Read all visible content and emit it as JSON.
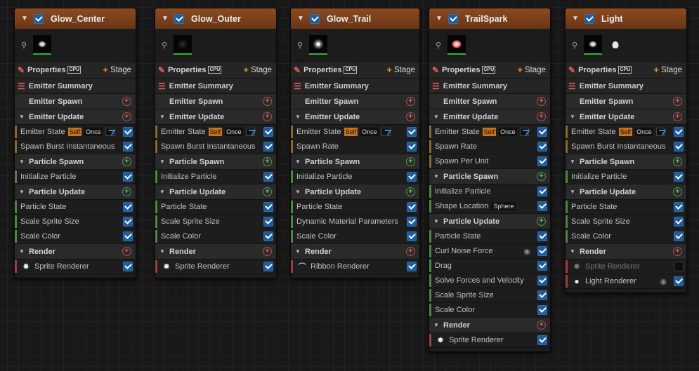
{
  "emitters": [
    {
      "name": "Glow_Center",
      "thumbnails": [
        "white-glow-dot"
      ],
      "properties_label": "Properties",
      "cpu_label": "CPU",
      "stage_label": "Stage",
      "summary_label": "Emitter Summary",
      "groups": [
        {
          "label": "Emitter Spawn",
          "collapsible": false,
          "add_color": "red",
          "modules": []
        },
        {
          "label": "Emitter Update",
          "collapsible": true,
          "add_color": "red",
          "modules": [
            {
              "label": "Emitter State",
              "tags": [
                "Self",
                "Once"
              ],
              "curve": true,
              "enabled": true
            },
            {
              "label": "Spawn Burst Instantaneous",
              "enabled": true
            }
          ]
        },
        {
          "label": "Particle Spawn",
          "collapsible": true,
          "add_color": "green",
          "modules": [
            {
              "label": "Initialize Particle",
              "enabled": true
            }
          ]
        },
        {
          "label": "Particle Update",
          "collapsible": true,
          "add_color": "green",
          "modules": [
            {
              "label": "Particle State",
              "enabled": true
            },
            {
              "label": "Scale Sprite Size",
              "enabled": true
            },
            {
              "label": "Scale Color",
              "enabled": true
            }
          ]
        },
        {
          "label": "Render",
          "collapsible": true,
          "add_color": "red",
          "modules": [
            {
              "label": "Sprite Renderer",
              "icon": "sprite-icon",
              "enabled": true
            }
          ]
        }
      ]
    },
    {
      "name": "Glow_Outer",
      "thumbnails": [
        "dim-glow"
      ],
      "properties_label": "Properties",
      "cpu_label": "CPU",
      "stage_label": "Stage",
      "summary_label": "Emitter Summary",
      "groups": [
        {
          "label": "Emitter Spawn",
          "collapsible": false,
          "add_color": "red",
          "modules": []
        },
        {
          "label": "Emitter Update",
          "collapsible": true,
          "add_color": "red",
          "modules": [
            {
              "label": "Emitter State",
              "tags": [
                "Self",
                "Once"
              ],
              "curve": true,
              "enabled": true
            },
            {
              "label": "Spawn Burst Instantaneous",
              "enabled": true
            }
          ]
        },
        {
          "label": "Particle Spawn",
          "collapsible": true,
          "add_color": "green",
          "modules": [
            {
              "label": "Initialize Particle",
              "enabled": true
            }
          ]
        },
        {
          "label": "Particle Update",
          "collapsible": true,
          "add_color": "green",
          "modules": [
            {
              "label": "Particle State",
              "enabled": true
            },
            {
              "label": "Scale Sprite Size",
              "enabled": true
            },
            {
              "label": "Scale Color",
              "enabled": true
            }
          ]
        },
        {
          "label": "Render",
          "collapsible": true,
          "add_color": "red",
          "modules": [
            {
              "label": "Sprite Renderer",
              "icon": "sprite-icon",
              "enabled": true
            }
          ]
        }
      ]
    },
    {
      "name": "Glow_Trail",
      "thumbnails": [
        "spark-burst"
      ],
      "properties_label": "Properties",
      "cpu_label": "CPU",
      "stage_label": "Stage",
      "summary_label": "Emitter Summary",
      "groups": [
        {
          "label": "Emitter Spawn",
          "collapsible": false,
          "add_color": "red",
          "modules": []
        },
        {
          "label": "Emitter Update",
          "collapsible": true,
          "add_color": "red",
          "modules": [
            {
              "label": "Emitter State",
              "tags": [
                "Self",
                "Once"
              ],
              "curve": true,
              "enabled": true
            },
            {
              "label": "Spawn Rate",
              "enabled": true
            }
          ]
        },
        {
          "label": "Particle Spawn",
          "collapsible": true,
          "add_color": "green",
          "modules": [
            {
              "label": "Initialize Particle",
              "enabled": true
            }
          ]
        },
        {
          "label": "Particle Update",
          "collapsible": true,
          "add_color": "green",
          "modules": [
            {
              "label": "Particle State",
              "enabled": true
            },
            {
              "label": "Dynamic Material Parameters",
              "enabled": true
            },
            {
              "label": "Scale Color",
              "enabled": true
            }
          ]
        },
        {
          "label": "Render",
          "collapsible": true,
          "add_color": "red",
          "modules": [
            {
              "label": "Ribbon Renderer",
              "icon": "ribbon-icon",
              "enabled": true
            }
          ]
        }
      ]
    },
    {
      "name": "TrailSpark",
      "thumbnails": [
        "pink-glow"
      ],
      "properties_label": "Properties",
      "cpu_label": "CPU",
      "stage_label": "Stage",
      "summary_label": "Emitter Summary",
      "groups": [
        {
          "label": "Emitter Spawn",
          "collapsible": false,
          "add_color": "red",
          "modules": []
        },
        {
          "label": "Emitter Update",
          "collapsible": true,
          "add_color": "red",
          "modules": [
            {
              "label": "Emitter State",
              "tags": [
                "Self",
                "Once"
              ],
              "curve": true,
              "enabled": true
            },
            {
              "label": "Spawn Rate",
              "enabled": true
            },
            {
              "label": "Spawn Per Unit",
              "enabled": true
            }
          ]
        },
        {
          "label": "Particle Spawn",
          "collapsible": true,
          "add_color": "green",
          "modules": [
            {
              "label": "Initialize Particle",
              "enabled": true
            },
            {
              "label": "Shape Location",
              "tags": [
                "Sphere"
              ],
              "enabled": true
            }
          ]
        },
        {
          "label": "Particle Update",
          "collapsible": true,
          "add_color": "green",
          "modules": [
            {
              "label": "Particle State",
              "enabled": true
            },
            {
              "label": "Curl Noise Force",
              "eye": true,
              "enabled": true
            },
            {
              "label": "Drag",
              "enabled": true
            },
            {
              "label": "Solve Forces and Velocity",
              "enabled": true
            },
            {
              "label": "Scale Sprite Size",
              "enabled": true
            },
            {
              "label": "Scale Color",
              "enabled": true
            }
          ]
        },
        {
          "label": "Render",
          "collapsible": true,
          "add_color": "red",
          "modules": [
            {
              "label": "Sprite Renderer",
              "icon": "sprite-icon",
              "enabled": true
            }
          ]
        }
      ]
    },
    {
      "name": "Light",
      "thumbnails": [
        "white-glow-dot",
        "light-bulb"
      ],
      "properties_label": "Properties",
      "cpu_label": "CPU",
      "stage_label": "Stage",
      "summary_label": "Emitter Summary",
      "groups": [
        {
          "label": "Emitter Spawn",
          "collapsible": false,
          "add_color": "red",
          "modules": []
        },
        {
          "label": "Emitter Update",
          "collapsible": true,
          "add_color": "red",
          "modules": [
            {
              "label": "Emitter State",
              "tags": [
                "Self",
                "Once"
              ],
              "curve": true,
              "enabled": true
            },
            {
              "label": "Spawn Burst Instantaneous",
              "enabled": true
            }
          ]
        },
        {
          "label": "Particle Spawn",
          "collapsible": true,
          "add_color": "green",
          "modules": [
            {
              "label": "Initialize Particle",
              "enabled": true
            }
          ]
        },
        {
          "label": "Particle Update",
          "collapsible": true,
          "add_color": "green",
          "modules": [
            {
              "label": "Particle State",
              "enabled": true
            },
            {
              "label": "Scale Sprite Size",
              "enabled": true
            },
            {
              "label": "Scale Color",
              "enabled": true
            }
          ]
        },
        {
          "label": "Render",
          "collapsible": true,
          "add_color": "red",
          "modules": [
            {
              "label": "Sprite Renderer",
              "icon": "sprite-icon",
              "enabled": false
            },
            {
              "label": "Light Renderer",
              "icon": "light-bulb-icon",
              "eye": true,
              "enabled": true
            }
          ]
        }
      ]
    }
  ],
  "colors": {
    "header": "#7a3f1a",
    "checkbox_on": "#1e5c9c",
    "self_tag": "#c8731c",
    "add_red": "#d06060",
    "add_green": "#67b867",
    "canvas": "#181818"
  }
}
